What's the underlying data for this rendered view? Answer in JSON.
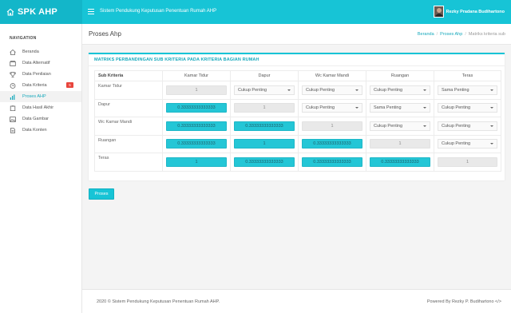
{
  "header": {
    "brand": "SPK AHP",
    "app_title": "Sistem Pendukung Keputusan Penentuan Rumah AHP",
    "user_name": "Rezky Pradana Budihartono"
  },
  "sidebar": {
    "heading": "NAVIGATION",
    "items": [
      {
        "label": "Beranda",
        "icon": "home-icon"
      },
      {
        "label": "Data Alternatif",
        "icon": "box-icon"
      },
      {
        "label": "Data Penilaian",
        "icon": "trophy-icon"
      },
      {
        "label": "Data Kriteria",
        "icon": "clock-icon",
        "badge": "5"
      },
      {
        "label": "Proses AHP",
        "icon": "bar-chart-icon",
        "active": true
      },
      {
        "label": "Data Hasil Akhir",
        "icon": "clipboard-icon"
      },
      {
        "label": "Data Gambar",
        "icon": "image-icon"
      },
      {
        "label": "Data Konten",
        "icon": "document-icon"
      }
    ]
  },
  "page": {
    "title": "Proses Ahp",
    "breadcrumb": [
      "Beranda",
      "Proses Ahp",
      "Matriks kriteria sub"
    ]
  },
  "matrix": {
    "title": "MATRIKS PERBANDINGAN SUB KRITERIA PADA KRITERIA BAGIAN RUMAH",
    "corner_label": "Sub Kriteria",
    "columns": [
      "Kamar Tidur",
      "Dapur",
      "Wc Kamar Mandi",
      "Ruangan",
      "Teras"
    ],
    "rows": [
      {
        "label": "Kamar Tidur",
        "cells": [
          "1",
          "Cukup Penting",
          "Cukup Penting",
          "Cukup Penting",
          "Sama Penting"
        ]
      },
      {
        "label": "Dapur",
        "cells": [
          "0.33333333333333",
          "1",
          "Cukup Penting",
          "Sama Penting",
          "Cukup Penting"
        ]
      },
      {
        "label": "Wc Kamar Mandi",
        "cells": [
          "0.33333333333333",
          "0.33333333333333",
          "1",
          "Cukup Penting",
          "Cukup Penting"
        ]
      },
      {
        "label": "Ruangan",
        "cells": [
          "0.33333333333333",
          "1",
          "0.33333333333333",
          "1",
          "Cukup Penting"
        ]
      },
      {
        "label": "Teras",
        "cells": [
          "1",
          "0.33333333333333",
          "0.33333333333333",
          "0.33333333333333",
          "1"
        ]
      }
    ]
  },
  "actions": {
    "proses_label": "Proses"
  },
  "footer": {
    "left": "2020 © Sistem Pendukung Keputusan Penentuan Rumah AHP.",
    "right": "Powered By Rezky P. Budihartono </>"
  },
  "colors": {
    "accent": "#17c4d6",
    "badge": "#e8453c"
  }
}
